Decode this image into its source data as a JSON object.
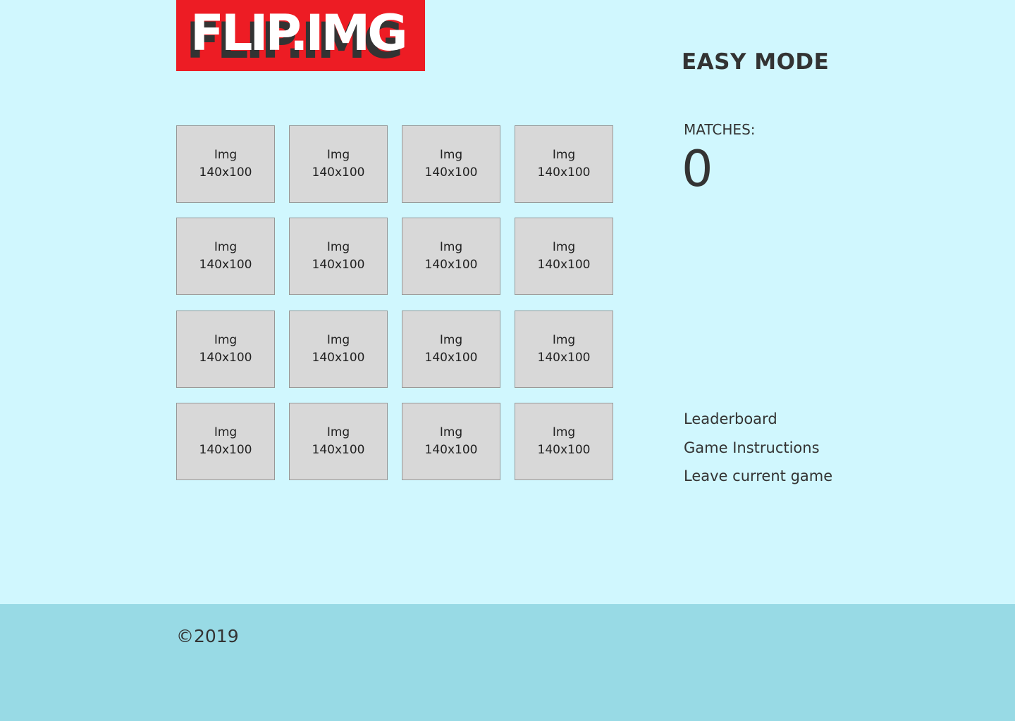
{
  "header": {
    "logo_text": "FLIP.IMG",
    "mode_title": "EASY MODE"
  },
  "board": {
    "cards": [
      {
        "line1": "Img",
        "line2": "140x100"
      },
      {
        "line1": "Img",
        "line2": "140x100"
      },
      {
        "line1": "Img",
        "line2": "140x100"
      },
      {
        "line1": "Img",
        "line2": "140x100"
      },
      {
        "line1": "Img",
        "line2": "140x100"
      },
      {
        "line1": "Img",
        "line2": "140x100"
      },
      {
        "line1": "Img",
        "line2": "140x100"
      },
      {
        "line1": "Img",
        "line2": "140x100"
      },
      {
        "line1": "Img",
        "line2": "140x100"
      },
      {
        "line1": "Img",
        "line2": "140x100"
      },
      {
        "line1": "Img",
        "line2": "140x100"
      },
      {
        "line1": "Img",
        "line2": "140x100"
      },
      {
        "line1": "Img",
        "line2": "140x100"
      },
      {
        "line1": "Img",
        "line2": "140x100"
      },
      {
        "line1": "Img",
        "line2": "140x100"
      },
      {
        "line1": "Img",
        "line2": "140x100"
      }
    ]
  },
  "score": {
    "matches_label": "MATCHES:",
    "matches_count": "0"
  },
  "menu": {
    "links": [
      {
        "label": "Leaderboard"
      },
      {
        "label": "Game Instructions"
      },
      {
        "label": "Leave current game"
      }
    ]
  },
  "footer": {
    "copyright": "©2019"
  },
  "colors": {
    "background": "#d0f7fe",
    "footer_background": "#98dae5",
    "logo_background": "#ed1c24",
    "card_background": "#d8d8d8",
    "text": "#333333"
  }
}
